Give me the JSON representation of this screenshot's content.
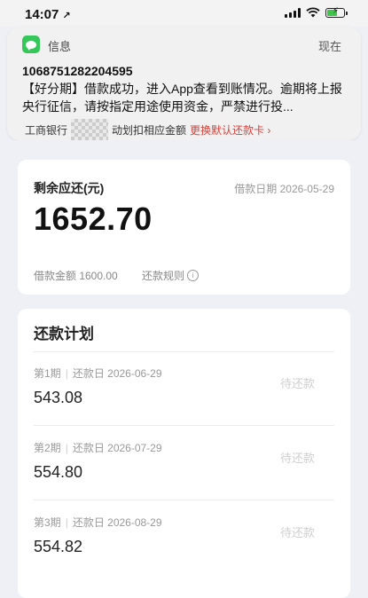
{
  "status_bar": {
    "time": "14:07",
    "location_arrow": "↗"
  },
  "notification": {
    "app_name": "信息",
    "time": "现在",
    "sender": "1068751282204595",
    "body": "【好分期】借款成功，进入App查看到账情况。逾期将上报央行征信，请按指定用途使用资金，严禁进行投..."
  },
  "bank_line": {
    "prefix": "工商银行",
    "middle": "动划扣相应金额",
    "link": "更换默认还款卡 ›"
  },
  "summary": {
    "remaining_label": "剩余应还(元)",
    "loan_date": "借款日期 2026-05-29",
    "remaining_amount": "1652.70",
    "loan_amount": "借款金额 1600.00",
    "rules_label": "还款规则"
  },
  "plan": {
    "title": "还款计划",
    "rows": [
      {
        "period": "第1期",
        "date": "还款日 2026-06-29",
        "amount": "543.08",
        "status": "待还款"
      },
      {
        "period": "第2期",
        "date": "还款日 2026-07-29",
        "amount": "554.80",
        "status": "待还款"
      },
      {
        "period": "第3期",
        "date": "还款日 2026-08-29",
        "amount": "554.82",
        "status": "待还款"
      }
    ]
  },
  "colors": {
    "accent_red": "#e23c35",
    "message_green": "#35c759"
  }
}
